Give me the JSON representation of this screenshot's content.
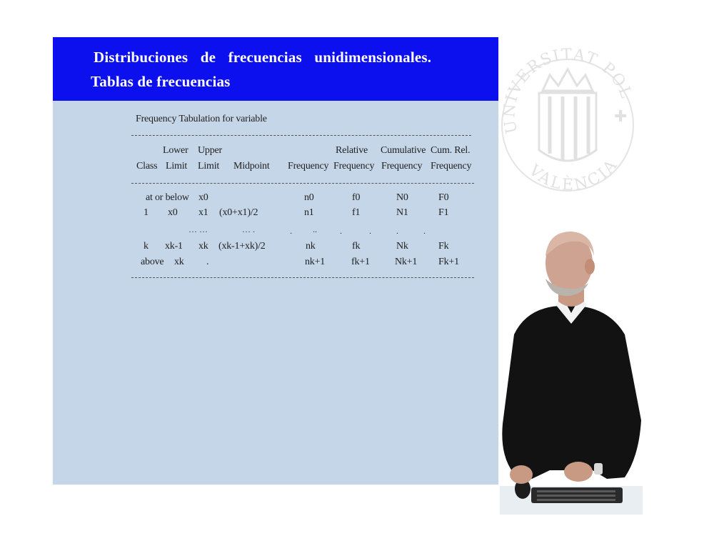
{
  "slide": {
    "title_line1": "Distribuciones de frecuencias unidimensionales.",
    "title_line2": "Tablas de frecuencias"
  },
  "table": {
    "caption": "Frequency Tabulation for variable",
    "header_top": {
      "lower": "Lower",
      "upper": "Upper",
      "relative": "Relative",
      "cumulative": "Cumulative",
      "cumrel": "Cum. Rel."
    },
    "header_bottom": {
      "class": "Class",
      "limit_lower": "Limit",
      "limit_upper": "Limit",
      "midpoint": "Midpoint",
      "frequency": "Frequency",
      "rel_frequency": "Frequency",
      "cum_frequency": "Frequency",
      "cumrel_frequency": "Frequency"
    },
    "rows": [
      {
        "class": "at or below",
        "lower": "",
        "upper": "x0",
        "midpoint": "",
        "freq": "n0",
        "rel": "f0",
        "cum": "N0",
        "cumrel": "F0"
      },
      {
        "class": "1",
        "lower": "x0",
        "upper": "x1",
        "midpoint": "(x0+x1)/2",
        "freq": "n1",
        "rel": "f1",
        "cum": "N1",
        "cumrel": "F1"
      },
      {
        "class": "k",
        "lower": "xk-1",
        "upper": "xk",
        "midpoint": "(xk-1+xk)/2",
        "freq": "nk",
        "rel": "fk",
        "cum": "Nk",
        "cumrel": "Fk"
      },
      {
        "class": "above",
        "lower": "xk",
        "upper": ".",
        "midpoint": "",
        "freq": "nk+1",
        "rel": "fk+1",
        "cum": "Nk+1",
        "cumrel": "Fk+1"
      }
    ],
    "ellipsis_row": {
      "a": "…  …",
      "b": "…  .",
      "c": ".",
      "d": "..",
      "e": ".",
      "f": ".",
      "g": ".",
      "h": "."
    }
  },
  "colors": {
    "header_blue": "#0d10ee",
    "slide_bg": "#c5d6e8"
  },
  "seal": {
    "text_top": "UNIVERSITAT POLITÈCNICA",
    "text_bottom": "VALÈNCIA"
  }
}
